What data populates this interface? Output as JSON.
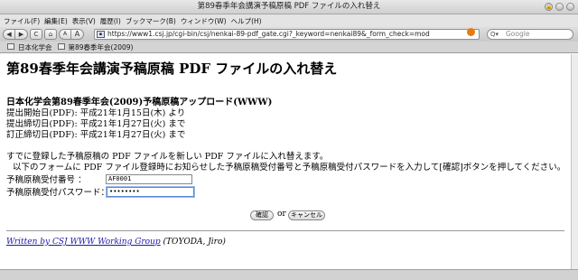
{
  "window": {
    "title": "第89春季年会講演予稿原稿 PDF ファイルの入れ替え"
  },
  "menu": [
    "ファイル(F)",
    "編集(E)",
    "表示(V)",
    "履歴(I)",
    "ブックマーク(B)",
    "ウィンドウ(W)",
    "ヘルプ(H)"
  ],
  "nav": {
    "back_glyph": "◀",
    "forward_glyph": "▶",
    "reload_glyph": "C",
    "home_glyph": "⌂",
    "text_smaller": "A",
    "text_larger": "A",
    "url": "https://www1.csj.jp/cgi-bin/csj/nenkai-89-pdf_gate.cgi?_keyword=nenkai89&_form_check=mod",
    "favicon_glyph": "▪",
    "rss_glyph": "●",
    "search_placeholder": "Google",
    "search_glyph": "Q▾"
  },
  "bookmarks": [
    "日本化学会",
    "第89春季年会(2009)"
  ],
  "page": {
    "title": "第89春季年会講演予稿原稿 PDF ファイルの入れ替え",
    "section_heading": "日本化学会第89春季年会(2009)予稿原稿アップロード(WWW)",
    "dates": [
      "提出開始日(PDF): 平成21年1月15日(木) より",
      "提出締切日(PDF): 平成21年1月27日(火) まで",
      "訂正締切日(PDF): 平成21年1月27日(火) まで"
    ],
    "instruction_1": "すでに登録した予稿原稿の PDF ファイルを新しい PDF ファイルに入れ替えます。",
    "instruction_2": "以下のフォームに PDF ファイル登録時にお知らせした予稿原稿受付番号と予稿原稿受付パスワードを入力して[確認]ボタンを押してください。",
    "form": {
      "receipt_label": "予稿原稿受付番号 ：",
      "receipt_value": "AF0001",
      "password_label": "予稿原稿受付パスワード：",
      "password_value": "••••••••",
      "confirm_label": "確認",
      "or_text": "or",
      "cancel_label": "キャンセル"
    },
    "footer_link": "Written by CSJ WWW Working Group",
    "footer_author": "(TOYODA, Jiro)"
  }
}
